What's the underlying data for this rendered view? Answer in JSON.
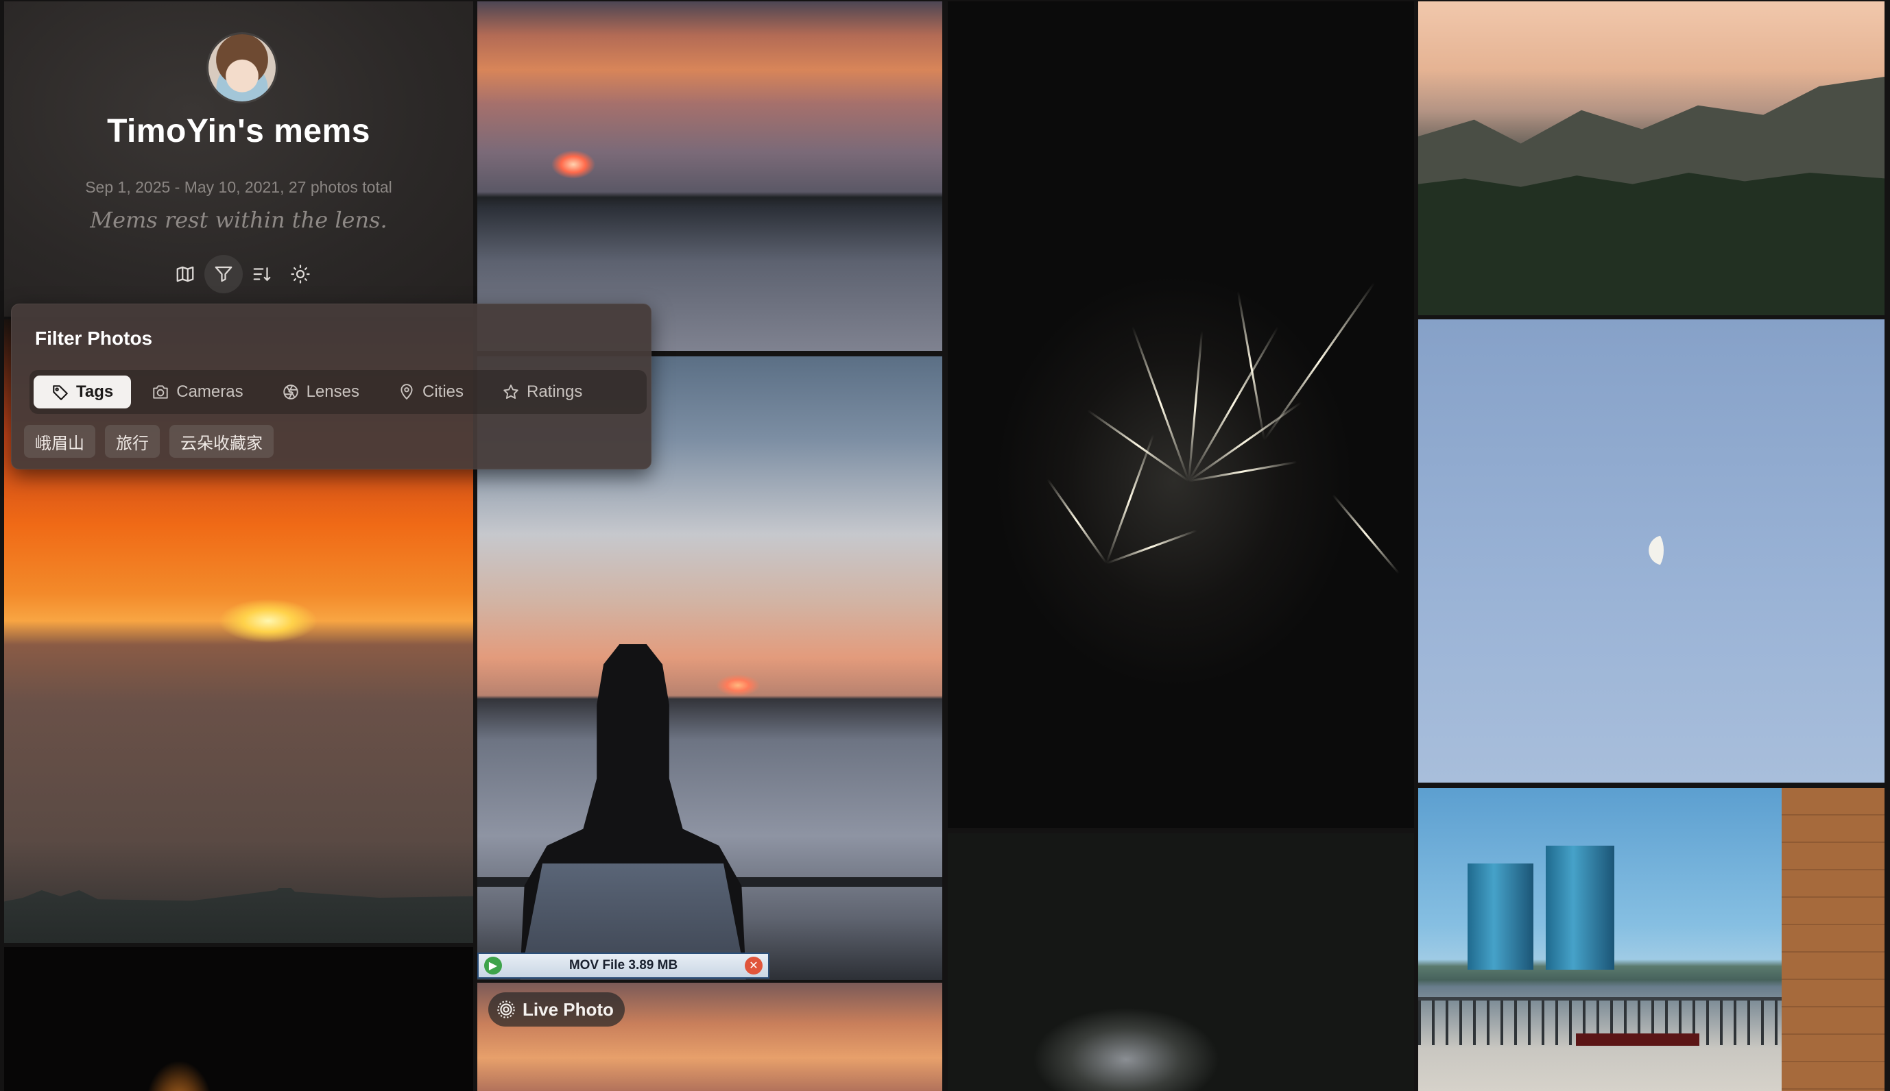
{
  "profile": {
    "title": "TimoYin's mems",
    "stats": "Sep 1, 2025 - May 10, 2021, 27 photos total",
    "tagline": "Mems rest within the lens.",
    "toolbar": [
      "map-icon",
      "filter-icon",
      "sort-icon",
      "sun-icon"
    ]
  },
  "filter": {
    "title": "Filter Photos",
    "tabs": [
      {
        "label": "Tags",
        "icon": "tag-icon",
        "active": true
      },
      {
        "label": "Cameras",
        "icon": "camera-icon"
      },
      {
        "label": "Lenses",
        "icon": "aperture-icon"
      },
      {
        "label": "Cities",
        "icon": "map-pin-icon"
      },
      {
        "label": "Ratings",
        "icon": "star-icon"
      }
    ],
    "tags": [
      "峨眉山",
      "旅行",
      "云朵收藏家"
    ]
  },
  "overlays": {
    "mov_file": "MOV File 3.89 MB",
    "live_photo": "Live Photo"
  },
  "colors": {
    "background": "#141313",
    "active_tab": "#f3f1ef"
  }
}
